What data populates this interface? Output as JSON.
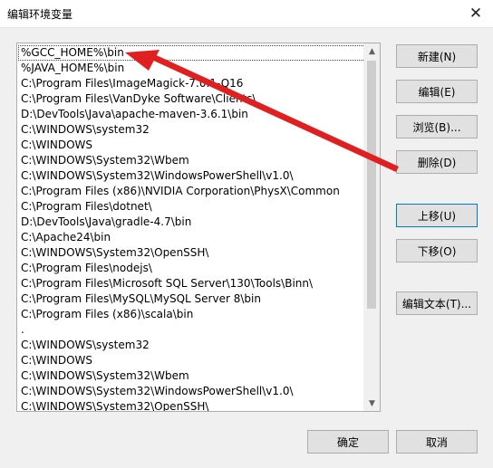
{
  "window": {
    "title": "编辑环境变量",
    "close_glyph": "✕"
  },
  "paths": [
    "%GCC_HOME%\\bin",
    "%JAVA_HOME%\\bin",
    "C:\\Program Files\\ImageMagick-7.0.1-Q16",
    "C:\\Program Files\\VanDyke Software\\Clients\\",
    "D:\\DevTools\\Java\\apache-maven-3.6.1\\bin",
    "C:\\WINDOWS\\system32",
    "C:\\WINDOWS",
    "C:\\WINDOWS\\System32\\Wbem",
    "C:\\WINDOWS\\System32\\WindowsPowerShell\\v1.0\\",
    "C:\\Program Files (x86)\\NVIDIA Corporation\\PhysX\\Common",
    "C:\\Program Files\\dotnet\\",
    "D:\\DevTools\\Java\\gradle-4.7\\bin",
    "C:\\Apache24\\bin",
    "C:\\WINDOWS\\System32\\OpenSSH\\",
    "C:\\Program Files\\nodejs\\",
    "C:\\Program Files\\Microsoft SQL Server\\130\\Tools\\Binn\\",
    "C:\\Program Files\\MySQL\\MySQL Server 8\\bin",
    "C:\\Program Files (x86)\\scala\\bin",
    ".",
    "C:\\WINDOWS\\system32",
    "C:\\WINDOWS",
    "C:\\WINDOWS\\System32\\Wbem",
    "C:\\WINDOWS\\System32\\WindowsPowerShell\\v1.0\\",
    "C:\\WINDOWS\\System32\\OpenSSH\\"
  ],
  "buttons": {
    "new": "新建(N)",
    "edit": "编辑(E)",
    "browse": "浏览(B)...",
    "delete": "删除(D)",
    "move_up": "上移(U)",
    "move_down": "下移(O)",
    "edit_text": "编辑文本(T)...",
    "ok": "确定",
    "cancel": "取消"
  },
  "icons": {
    "scroll_up": "▲",
    "scroll_down": "▼"
  },
  "annotation": {
    "color": "#e02020",
    "kind": "red-arrow"
  }
}
